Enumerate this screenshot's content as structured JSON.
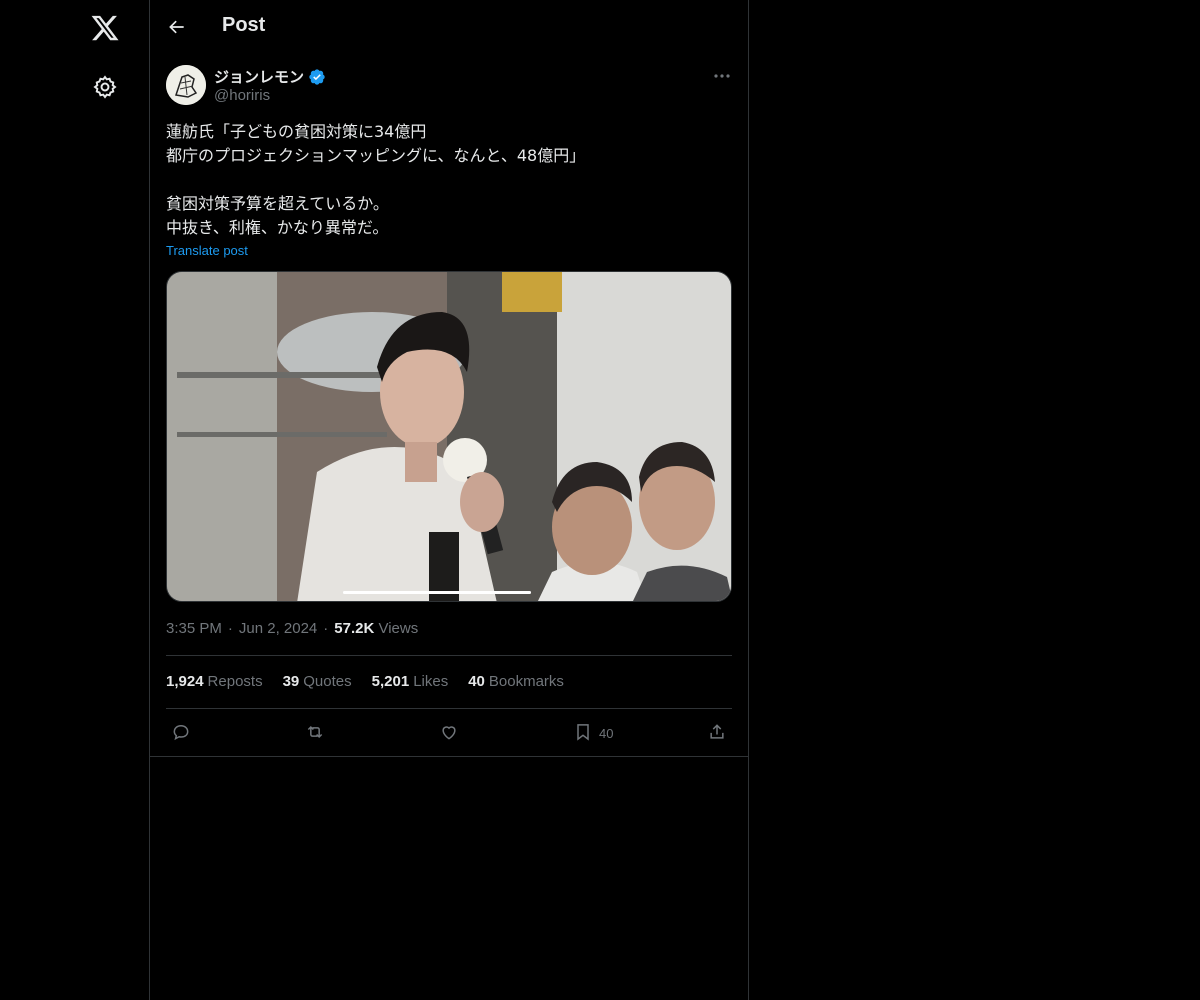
{
  "nav": {
    "logo_icon": "x-logo-icon",
    "settings_icon": "gear-icon"
  },
  "header": {
    "title": "Post",
    "back_icon": "arrow-left-icon"
  },
  "author": {
    "display_name": "ジョンレモン",
    "handle": "@horiris",
    "verified": true,
    "verified_color": "#1d9bf0"
  },
  "post": {
    "text": "蓮舫氏「子どもの貧困対策に34億円\n都庁のプロジェクションマッピングに、なんと、48億円」\n\n貧困対策予算を超えているか。\n中抜き、利権、かなり異常だ。",
    "translate_label": "Translate post",
    "video_progress": 1.0
  },
  "meta": {
    "time": "3:35 PM",
    "separator": "·",
    "date": "Jun 2, 2024",
    "views_count": "57.2K",
    "views_label": "Views"
  },
  "stats": [
    {
      "count": "1,924",
      "label": "Reposts"
    },
    {
      "count": "39",
      "label": "Quotes"
    },
    {
      "count": "5,201",
      "label": "Likes"
    },
    {
      "count": "40",
      "label": "Bookmarks"
    }
  ],
  "actions": {
    "reply_icon": "reply-icon",
    "repost_icon": "repost-icon",
    "like_icon": "heart-icon",
    "bookmark_icon": "bookmark-icon",
    "bookmark_count": "40",
    "share_icon": "share-icon"
  },
  "colors": {
    "background": "#000000",
    "text": "#e7e9ea",
    "muted": "#71767b",
    "border": "#2f3336",
    "accent": "#1d9bf0"
  }
}
